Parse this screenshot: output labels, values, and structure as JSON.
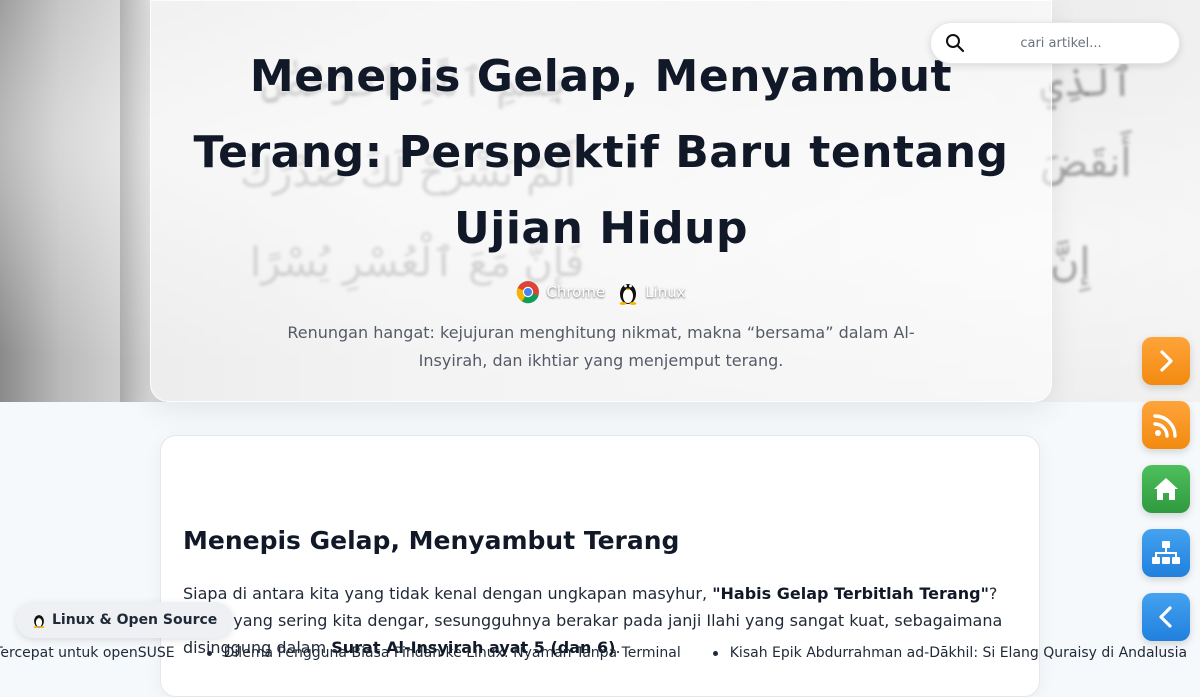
{
  "hero": {
    "title": "Menepis Gelap, Menyambut Terang: Perspektif Baru tentang Ujian Hidup",
    "badges": [
      {
        "label": "Chrome",
        "icon": "chrome-icon"
      },
      {
        "label": "Linux",
        "icon": "tux-icon"
      }
    ],
    "subtitle": "Renungan hangat: kejujuran menghitung nikmat, makna “bersama” dalam Al-Insyirah, dan ikhtiar yang menjemput terang."
  },
  "search": {
    "placeholder": "cari artikel..."
  },
  "article": {
    "heading": "Menepis Gelap, Menyambut Terang",
    "para_1": "Siapa di antara kita yang tidak kenal dengan ungkapan masyhur, ",
    "para_bold_1": "\"Habis Gelap Terbitlah Terang\"",
    "para_2": "? … ini, yang sering kita dengar, sesungguhnya berakar pada janji Ilahi yang sangat kuat, sebagaimana disinggung dalam ",
    "para_bold_2": "Surat Al-Insyirah ayat 5 (dan 6)",
    "para_3": "."
  },
  "side_buttons": [
    {
      "name": "next-button",
      "icon": "chevron-right-icon",
      "color": "#f7931e"
    },
    {
      "name": "rss-button",
      "icon": "rss-icon",
      "color": "#f7931e"
    },
    {
      "name": "home-button",
      "icon": "home-icon",
      "color": "#3aa54a"
    },
    {
      "name": "sitemap-button",
      "icon": "sitemap-icon",
      "color": "#2f8be6"
    },
    {
      "name": "back-button",
      "icon": "chevron-left-icon",
      "color": "#2f8be6"
    }
  ],
  "chip": {
    "label": "Linux & Open Source",
    "icon": "tux-icon"
  },
  "ticker": [
    "ror Tercepat untuk openSUSE",
    "Dilema Pengguna Biasa Pindah ke Linux: Nyaman Tanpa Terminal",
    "Kisah Epik Abdurrahman ad-Dākhil: Si Elang Quraisy di Andalusia"
  ]
}
